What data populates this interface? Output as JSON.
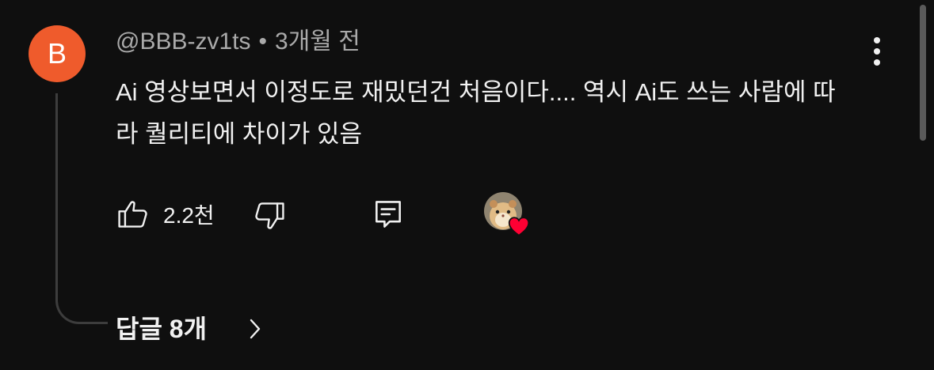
{
  "author": {
    "initial": "B",
    "handle": "@BBB-zv1ts",
    "separator": "•",
    "time": "3개월 전",
    "avatar_color": "#ef5b2c"
  },
  "comment": {
    "text": "Ai 영상보면서 이정도로 재밌던건 처음이다.... 역시 Ai도 쓰는 사람에 따라 퀄리티에 차이가 있음"
  },
  "actions": {
    "like_icon": "thumbs-up-icon",
    "like_count": "2.2천",
    "dislike_icon": "thumbs-down-icon",
    "reply_icon": "reply-comment-icon",
    "creator_heart_icon": "creator-heart-icon",
    "heart_color": "#ff0033"
  },
  "menu": {
    "icon": "more-vert-icon"
  },
  "replies": {
    "label": "답글 8개",
    "icon": "chevron-right-icon"
  },
  "theme": {
    "background": "#0f0f0f",
    "text": "#f1f1f1",
    "secondary_text": "#aaaaaa"
  }
}
